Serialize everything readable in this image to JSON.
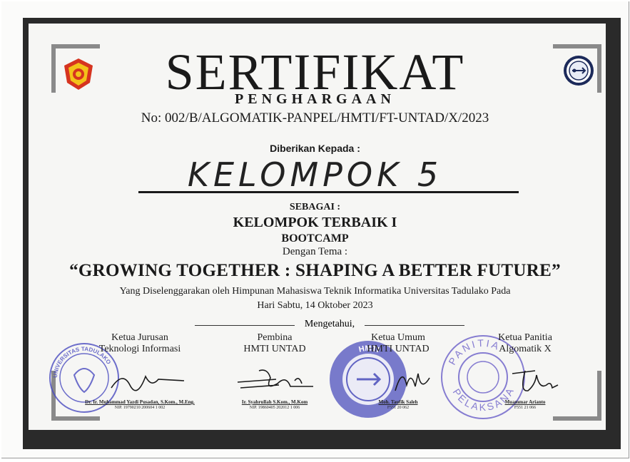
{
  "certificate": {
    "title": "SERTIFIKAT",
    "subtitle": "PENGHARGAAN",
    "number": "No: 002/B/ALGOMATIK-PANPEL/HMTI/FT-UNTAD/X/2023",
    "given_to_label": "Diberikan Kepada :",
    "recipient": "KELOMPOK 5",
    "as_label": "SEBAGAI :",
    "award": "KELOMPOK TERBAIK I",
    "event": "BOOTCAMP",
    "theme_label": "Dengan Tema :",
    "theme": "“GROWING TOGETHER : SHAPING A BETTER FUTURE”",
    "organizer": "Yang Diselenggarakan oleh Himpunan Mahasiswa Teknik Informatika Universitas Tadulako Pada",
    "date": "Hari Sabtu, 14 Oktober 2023",
    "acknowledged": "Mengetahui,"
  },
  "signatories": [
    {
      "role1": "Ketua Jurusan",
      "role2": "Teknologi Informasi",
      "name": "Dr. Ir. Muhammad Yazdi Pusadan, S.Kom., M.Eng.",
      "id": "NIP. 19790210 200604 1 002"
    },
    {
      "role1": "Pembina",
      "role2": "HMTI UNTAD",
      "name": "Ir. Syahrullah S.Kom., M.Kom",
      "id": "NIP. 19860405 202012 1 006"
    },
    {
      "role1": "Ketua Umum",
      "role2": "HMTI UNTAD",
      "name": "Moh. Taufik Saleh",
      "id": "F551 20 062"
    },
    {
      "role1": "Ketua Panitia",
      "role2": "Algomatik X",
      "name": "Muammar Arianto",
      "id": "F551 21 066"
    }
  ],
  "stamps": {
    "university": "UNIVERSITAS TADULAKO",
    "hmti": "HMTI",
    "panitia_top": "PANITIA",
    "panitia_bottom": "PELAKSANA"
  },
  "colors": {
    "frame": "#2a2a2a",
    "stamp_blue": "#3b3fb0",
    "stamp_violet": "#6b5fc9"
  }
}
